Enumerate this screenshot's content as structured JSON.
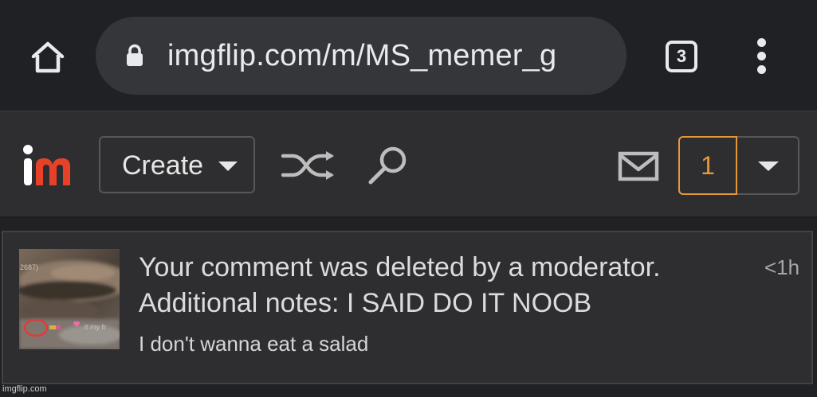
{
  "browser": {
    "url": "imgflip.com/m/MS_memer_g",
    "tab_count": "3",
    "icons": {
      "home": "home-icon",
      "lock": "lock-icon",
      "menu": "more-vert-icon"
    }
  },
  "navbar": {
    "logo_text": "im",
    "create_label": "Create",
    "notification_count": "1",
    "icons": {
      "shuffle": "shuffle-icon",
      "search": "search-icon",
      "mail": "mail-icon",
      "dropdown": "chevron-down-icon"
    },
    "colors": {
      "accent": "#e8963a",
      "logo_red": "#e8412a"
    }
  },
  "notification": {
    "line1": "Your comment was deleted by a moderator.",
    "line2": "Additional notes: I SAID DO IT NOOB",
    "comment": "I don't wanna eat a salad",
    "time": "<1h"
  },
  "thumbnail": {
    "caption_left": "2687)",
    "caption_right": "it my fr"
  },
  "watermark": "imgflip.com"
}
